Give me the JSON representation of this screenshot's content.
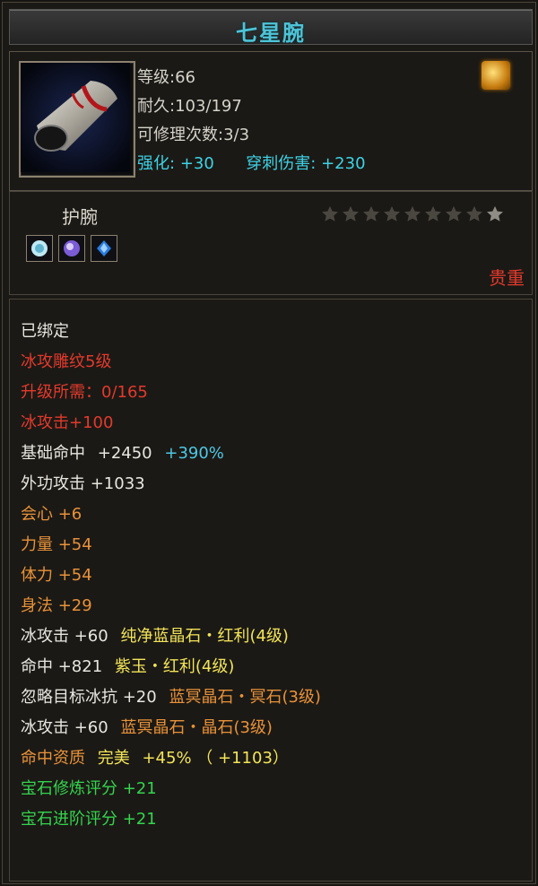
{
  "title": "七星腕",
  "colors": {
    "title": "#4fc3d6",
    "red": "#e23a2d",
    "orange": "#e8923a",
    "green": "#34d44e",
    "cyan": "#3fd2e6"
  },
  "item": {
    "icon": "bracer-icon",
    "level": "等级:66",
    "durability": "耐久:103/197",
    "repairs": "可修理次数:3/3",
    "enhance_label": "强化:",
    "enhance_value": "+30",
    "pierce_label": "穿刺伤害:",
    "pierce_value": "+230",
    "badge_icon": "flame-rank-icon"
  },
  "type": {
    "label": "护腕",
    "stars_total": 9,
    "stars_filled": 0,
    "gems": [
      "diamond-gem-icon",
      "purple-gem-icon",
      "blue-gem-icon"
    ],
    "rarity": "贵重"
  },
  "attributes": {
    "bound": "已绑定",
    "engrave": "冰攻雕纹5级",
    "upgrade": "升级所需：0/165",
    "ice_attack": "冰攻击+100",
    "hit_label": "基础命中",
    "hit_value": "+2450",
    "hit_pct": "+390%",
    "ext_attack": "外功攻击 +1033",
    "crit": "会心 +6",
    "strength": "力量 +54",
    "stamina": "体力 +54",
    "agility": "身法 +29",
    "gem1_stat": "冰攻击 +60",
    "gem1_name": "纯净蓝晶石・红利(4级)",
    "gem2_stat": "命中 +821",
    "gem2_name": "紫玉・红利(4级)",
    "gem3_stat": "忽略目标冰抗 +20",
    "gem3_name": "蓝冥晶石・冥石(3级)",
    "gem4_stat": "冰攻击 +60",
    "gem4_name": "蓝冥晶石・晶石(3级)",
    "quality_label": "命中资质",
    "quality_grade": "完美",
    "quality_pct": "+45%",
    "quality_bonus": "（ +1103）",
    "gem_refine": "宝石修炼评分 +21",
    "gem_advance": "宝石进阶评分 +21"
  }
}
